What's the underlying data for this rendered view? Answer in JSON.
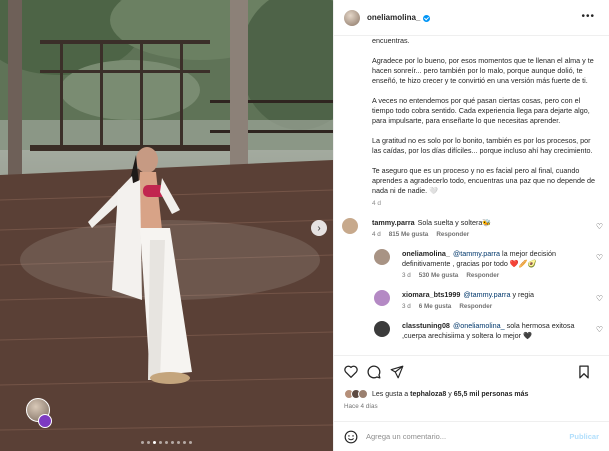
{
  "post": {
    "username": "oneliamolina_",
    "verified": true,
    "more_icon": "more-horizontal-icon"
  },
  "media": {
    "carousel_dots": 9,
    "active_dot": 3,
    "next_icon": "chevron-right-icon"
  },
  "caption": {
    "paragraphs": [
      "encuentras.",
      "Agradece por lo bueno, por esos momentos que te llenan el alma y te hacen sonreír... pero también por lo malo, porque aunque dolió, te enseñó, te hizo crecer y te convirtió en una versión más fuerte de ti.",
      "A veces no entendemos por qué pasan ciertas cosas, pero con el tiempo todo cobra sentido. Cada experiencia llega para dejarte algo, para impulsarte, para enseñarte lo que necesitas aprender.",
      "La gratitud no es solo por lo bonito, también es por los procesos, por las caídas, por los días difíciles... porque incluso ahí hay crecimiento.",
      "Te aseguro que es un proceso y no es facial pero al final, cuando aprendes a agradecerlo todo, encuentras una paz que no depende de nada ni de nadie. 🤍"
    ],
    "age": "4 d"
  },
  "comments": [
    {
      "username": "tammy.parra",
      "mention": "",
      "text": "Sola suelta y soltera🐝",
      "time": "4 d",
      "likes": "815 Me gusta",
      "reply": "Responder",
      "avatar_color": "#c7a98c",
      "is_reply": false
    },
    {
      "username": "oneliamolina_",
      "mention": "@tammy.parra",
      "text": "la mejor decisión definitivamente , gracias por todo ❤️🥖🥑",
      "time": "3 d",
      "likes": "530 Me gusta",
      "reply": "Responder",
      "avatar_color": "#a89384",
      "is_reply": true
    },
    {
      "username": "xiomara_bts1999",
      "mention": "@tammy.parra",
      "text": "y regia",
      "time": "3 d",
      "likes": "6 Me gusta",
      "reply": "Responder",
      "avatar_color": "#b489c4",
      "is_reply": true
    },
    {
      "username": "classtuning08",
      "mention": "@oneliamolina_",
      "text": "sola hermosa exitosa ,cuerpa arechisiima y soltera lo mejor 🖤",
      "time": "",
      "likes": "",
      "reply": "",
      "avatar_color": "#3b3b3b",
      "is_reply": true
    }
  ],
  "actions": {
    "like_icon": "heart-icon",
    "comment_icon": "comment-icon",
    "share_icon": "share-icon",
    "save_icon": "bookmark-icon"
  },
  "likes": {
    "prefix": "Les gusta a ",
    "user": "tephaloza8",
    "middle": " y ",
    "count": "65,5 mil personas más"
  },
  "posted": "Hace 4 días",
  "add_comment": {
    "placeholder": "Agrega un comentario...",
    "publish": "Publicar"
  }
}
